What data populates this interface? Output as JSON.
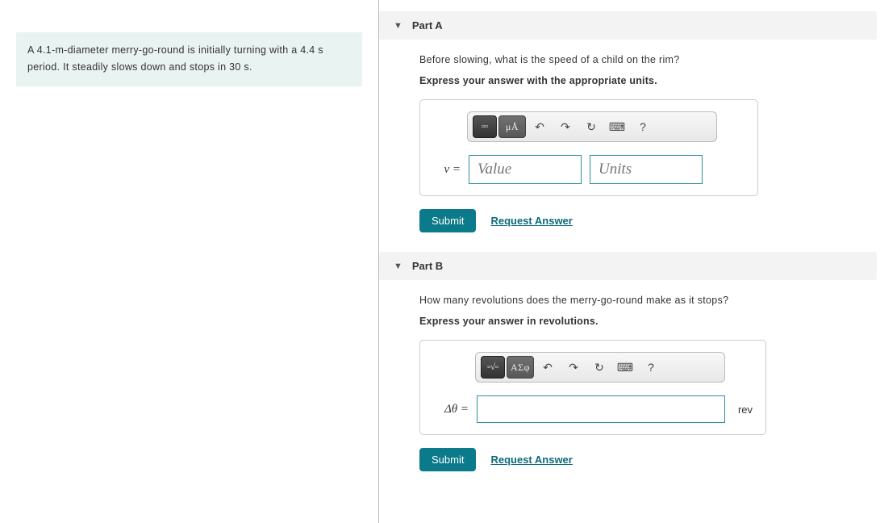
{
  "problem_statement": "A 4.1-m-diameter merry-go-round is initially turning with a 4.4 s period. It steadily slows down and stops in 30 s.",
  "partA": {
    "title": "Part A",
    "question": "Before slowing, what is the speed of a child on the rim?",
    "instruction": "Express your answer with the appropriate units.",
    "var_label": "v =",
    "value_placeholder": "Value",
    "units_placeholder": "Units",
    "toolbar": {
      "tmpl": "▫▫",
      "units": "μÅ",
      "undo": "↶",
      "redo": "↷",
      "reset": "↻",
      "kbd": "⌨",
      "help": "?"
    },
    "submit": "Submit",
    "request": "Request Answer"
  },
  "partB": {
    "title": "Part B",
    "question": "How many revolutions does the merry-go-round make as it stops?",
    "instruction": "Express your answer in revolutions.",
    "var_label": "Δθ =",
    "unit_suffix": "rev",
    "toolbar": {
      "tmpl": "▫√▫",
      "sym": "ΑΣφ",
      "undo": "↶",
      "redo": "↷",
      "reset": "↻",
      "kbd": "⌨",
      "help": "?"
    },
    "submit": "Submit",
    "request": "Request Answer"
  }
}
